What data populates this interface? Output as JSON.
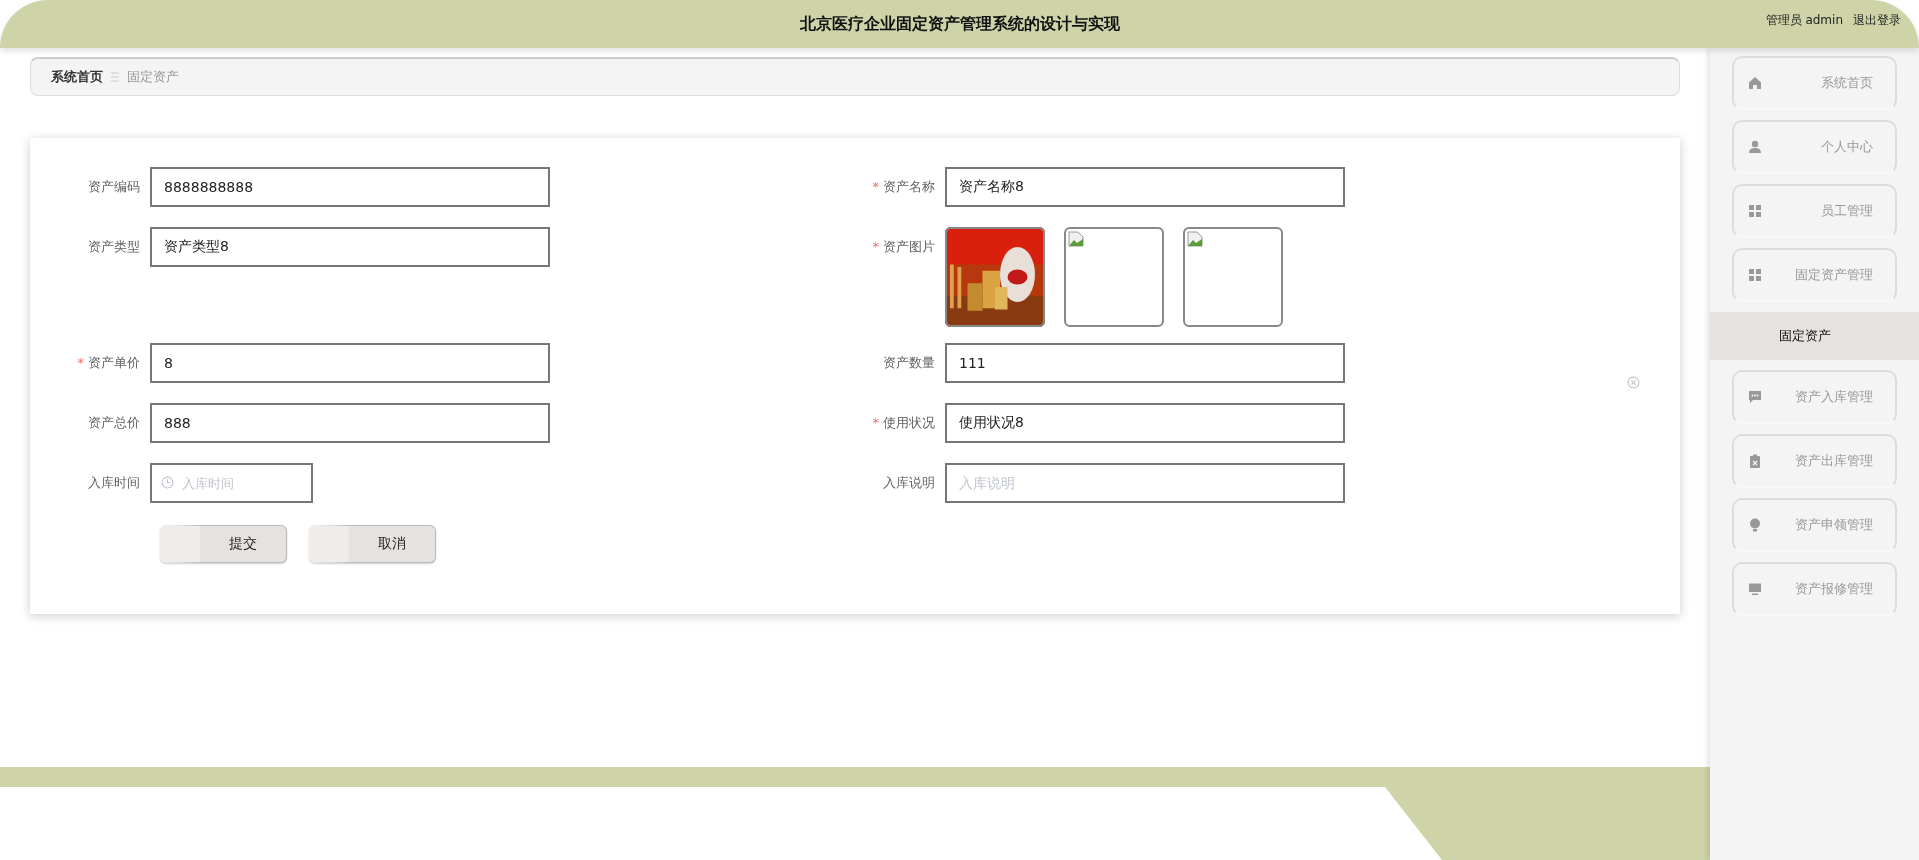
{
  "header": {
    "title": "北京医疗企业固定资产管理系统的设计与实现",
    "user": "管理员 admin",
    "logout": "退出登录"
  },
  "breadcrumb": [
    "系统首页",
    "固定资产"
  ],
  "form": {
    "rows": [
      {
        "left": {
          "label": "资产编码",
          "kind": "input",
          "value": "8888888888"
        },
        "right": {
          "label": "资产名称",
          "required_mark": "*",
          "kind": "input",
          "value": "资产名称8"
        }
      },
      {
        "left": {
          "label": "资产类型",
          "kind": "input",
          "value": "资产类型8"
        },
        "right": {
          "label": "资产图片",
          "required_mark": "*",
          "kind": "images",
          "images": [
            {
              "kind": "picture"
            },
            {
              "kind": "broken"
            },
            {
              "kind": "broken"
            }
          ]
        }
      },
      {
        "left": {
          "label": "资产单价",
          "required_mark": "*",
          "kind": "input",
          "value": "8"
        },
        "right": {
          "label": "资产数量",
          "kind": "input",
          "value": "111"
        }
      },
      {
        "left": {
          "label": "资产总价",
          "kind": "input",
          "value": "888"
        },
        "right": {
          "label": "使用状况",
          "required_mark": "*",
          "kind": "input",
          "value": "使用状况8"
        }
      },
      {
        "left": {
          "label": "入库时间",
          "kind": "date",
          "placeholder": "入库时间"
        },
        "right": {
          "label": "入库说明",
          "kind": "input",
          "placeholder": "入库说明"
        }
      }
    ],
    "buttons": [
      "提交",
      "取消"
    ]
  },
  "sidebar": {
    "items": [
      {
        "label": "系统首页",
        "kind": "home",
        "selected": false
      },
      {
        "label": "个人中心",
        "kind": "user",
        "selected": false
      },
      {
        "label": "员工管理",
        "kind": "grid",
        "selected": false
      },
      {
        "label": "固定资产管理",
        "kind": "grid",
        "selected": false
      },
      {
        "label": "固定资产",
        "kind": "sub",
        "selected": true
      },
      {
        "label": "资产入库管理",
        "kind": "chat",
        "selected": false
      },
      {
        "label": "资产出库管理",
        "kind": "clipboard",
        "selected": false
      },
      {
        "label": "资产申领管理",
        "kind": "bulb",
        "selected": false
      },
      {
        "label": "资产报修管理",
        "kind": "monitor",
        "selected": false
      }
    ]
  }
}
